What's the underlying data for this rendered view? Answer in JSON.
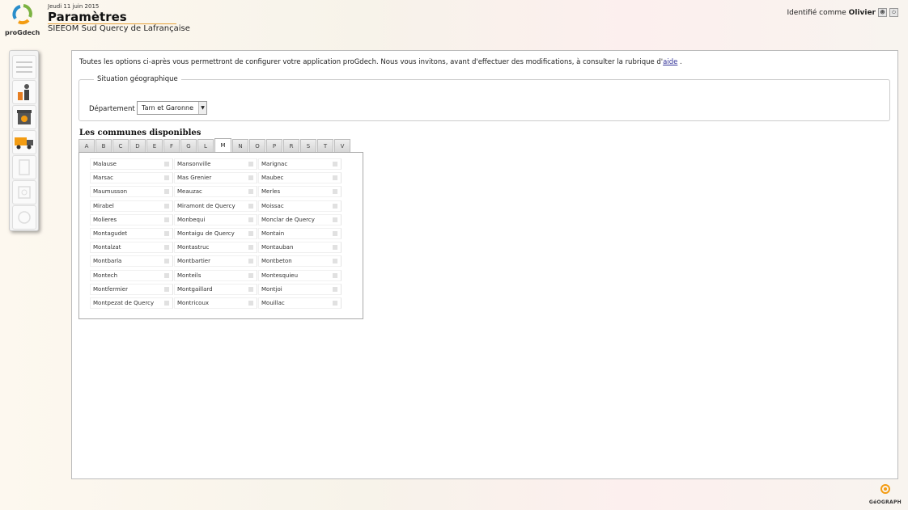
{
  "header": {
    "logo_text": "proGdech",
    "date": "Jeudi 11 juin 2015",
    "title": "Paramètres",
    "subtitle": "SIEEOM Sud Quercy de Lafrançaise"
  },
  "user": {
    "prefix": "Identifié comme",
    "name": "Olivier"
  },
  "sidebar": {
    "items": [
      {
        "icon": "menu-icon"
      },
      {
        "icon": "operator-icon"
      },
      {
        "icon": "bin-icon"
      },
      {
        "icon": "truck-icon"
      },
      {
        "icon": "document-icon"
      },
      {
        "icon": "settings-icon"
      },
      {
        "icon": "power-icon"
      }
    ]
  },
  "main": {
    "intro_text": "Toutes les options ci-après vous permettront de configurer votre application proGdech. Nous vous invitons, avant d'effectuer des modifications, à consulter la rubrique d'",
    "intro_link": "aide",
    "intro_end": " .",
    "geo_legend": "Situation géographique",
    "department_label": "Département :",
    "department_value": "Tarn et Garonne",
    "communes_title": "Les communes disponibles",
    "tabs": [
      "A",
      "B",
      "C",
      "D",
      "E",
      "F",
      "G",
      "L",
      "M",
      "N",
      "O",
      "P",
      "R",
      "S",
      "T",
      "V"
    ],
    "active_tab": "M",
    "communes": [
      "Malause",
      "Mansonville",
      "Marignac",
      "Marsac",
      "Mas Grenier",
      "Maubec",
      "Maumusson",
      "Meauzac",
      "Merles",
      "Mirabel",
      "Miramont de Quercy",
      "Moissac",
      "Molieres",
      "Monbequi",
      "Monclar de Quercy",
      "Montagudet",
      "Montaigu de Quercy",
      "Montain",
      "Montalzat",
      "Montastruc",
      "Montauban",
      "Montbarla",
      "Montbartier",
      "Montbeton",
      "Montech",
      "Monteils",
      "Montesquieu",
      "Montfermier",
      "Montgaillard",
      "Montjoi",
      "Montpezat de Quercy",
      "Montricoux",
      "Mouillac"
    ]
  },
  "footer": {
    "brand": "GéOGRAPH"
  }
}
